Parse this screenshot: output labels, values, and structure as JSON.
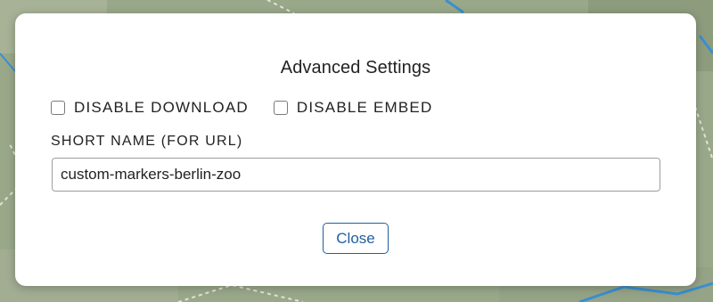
{
  "dialog": {
    "title": "Advanced Settings",
    "checkboxes": [
      {
        "label": "DISABLE DOWNLOAD",
        "checked": false
      },
      {
        "label": "DISABLE EMBED",
        "checked": false
      }
    ],
    "short_name": {
      "label": "SHORT NAME (FOR URL)",
      "value": "custom-markers-berlin-zoo"
    },
    "close_label": "Close"
  },
  "colors": {
    "map_background": "#9aa88a",
    "map_water": "#3a8fd0",
    "button_accent": "#1f5f9e"
  }
}
